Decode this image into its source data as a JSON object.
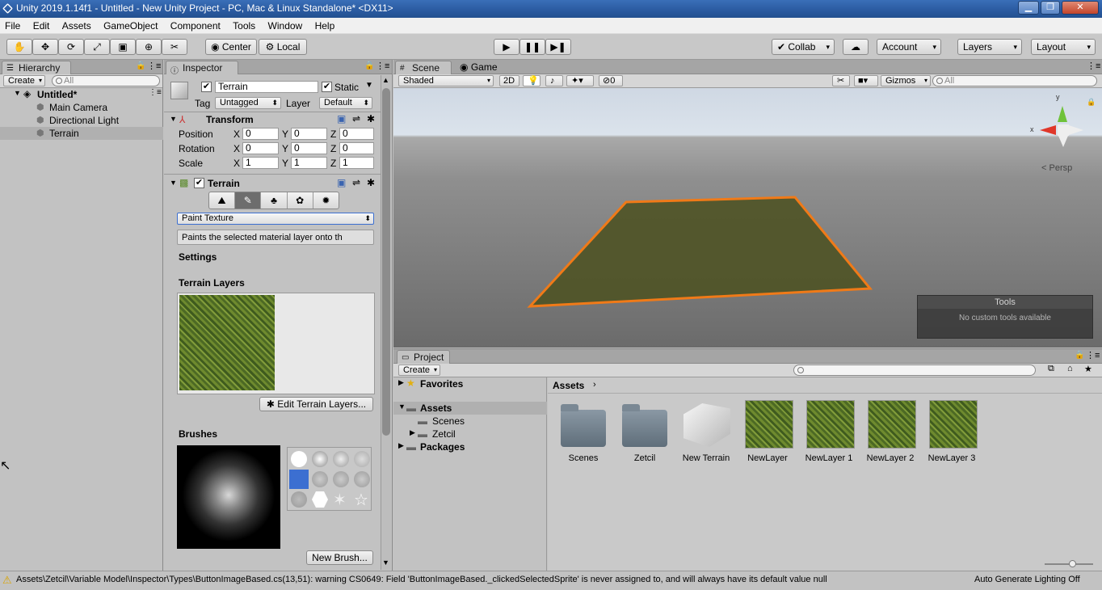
{
  "window": {
    "title": "Unity 2019.1.14f1 - Untitled - New Unity Project - PC, Mac & Linux Standalone* <DX11>"
  },
  "menu": [
    "File",
    "Edit",
    "Assets",
    "GameObject",
    "Component",
    "Tools",
    "Window",
    "Help"
  ],
  "toolbar": {
    "pivot": "Center",
    "space": "Local",
    "collab": "Collab",
    "account": "Account",
    "layers": "Layers",
    "layout": "Layout"
  },
  "hierarchy": {
    "tab": "Hierarchy",
    "create": "Create",
    "search_placeholder": "All",
    "scene": "Untitled*",
    "items": [
      "Main Camera",
      "Directional Light",
      "Terrain"
    ]
  },
  "inspector": {
    "tab": "Inspector",
    "object_name": "Terrain",
    "static_label": "Static",
    "tag_label": "Tag",
    "tag_value": "Untagged",
    "layer_label": "Layer",
    "layer_value": "Default",
    "transform": {
      "title": "Transform",
      "rows": [
        {
          "label": "Position",
          "x": "0",
          "y": "0",
          "z": "0"
        },
        {
          "label": "Rotation",
          "x": "0",
          "y": "0",
          "z": "0"
        },
        {
          "label": "Scale",
          "x": "1",
          "y": "1",
          "z": "1"
        }
      ],
      "axes": [
        "X",
        "Y",
        "Z"
      ]
    },
    "terrain": {
      "title": "Terrain",
      "tool_popup": "Paint Texture",
      "description": "Paints the selected material layer onto th",
      "settings": "Settings",
      "layers_heading": "Terrain Layers",
      "edit_layers_button": "Edit Terrain Layers...",
      "brushes_heading": "Brushes",
      "new_brush_button": "New Brush..."
    }
  },
  "scene": {
    "tabs": [
      "Scene",
      "Game"
    ],
    "shading": "Shaded",
    "mode_2d": "2D",
    "hidden_count": "0",
    "gizmos": "Gizmos",
    "search_placeholder": "All",
    "persp": "Persp",
    "gizmo_axes": {
      "x": "x",
      "y": "y"
    },
    "tools_overlay": {
      "title": "Tools",
      "message": "No custom tools available"
    }
  },
  "project": {
    "tab": "Project",
    "create": "Create",
    "tree": [
      {
        "label": "Favorites",
        "bold": true
      },
      {
        "label": "Assets",
        "bold": true
      },
      {
        "label": "Scenes",
        "bold": false
      },
      {
        "label": "Zetcil",
        "bold": false
      },
      {
        "label": "Packages",
        "bold": true
      }
    ],
    "breadcrumb": "Assets",
    "assets": [
      "Scenes",
      "Zetcil",
      "New Terrain",
      "NewLayer",
      "NewLayer 1",
      "NewLayer 2",
      "NewLayer 3"
    ]
  },
  "statusbar": {
    "warning": "Assets\\Zetcil\\Variable Model\\Inspector\\Types\\ButtonImageBased.cs(13,51): warning CS0649: Field 'ButtonImageBased._clickedSelectedSprite' is never assigned to, and will always have its default value null",
    "right": "Auto Generate Lighting Off"
  },
  "colors": {
    "selection_outline": "#f07a18",
    "title_bar": "#2a5aa0",
    "selected_row": "#b6b6b6",
    "sky": "#d3dde8",
    "ground": "#6a6a6a",
    "terrain": "#4f5426"
  }
}
